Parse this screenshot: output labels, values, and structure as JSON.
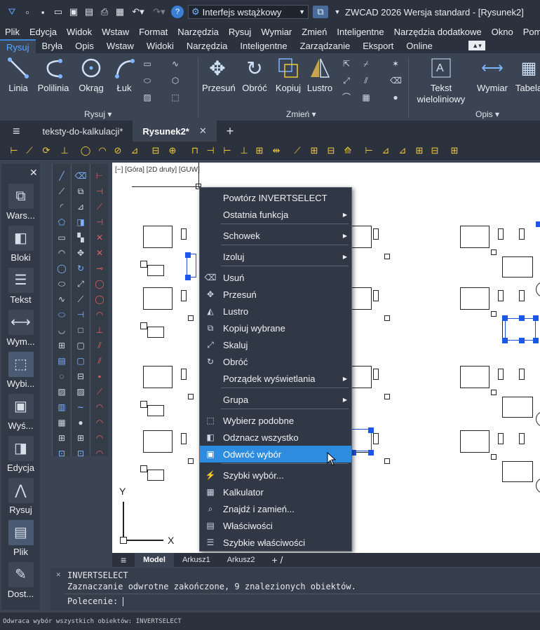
{
  "app": {
    "workspace": "Interfejs wstążkowy",
    "title": "ZWCAD 2026 Wersja standard - [Rysunek2]"
  },
  "menu": [
    "Plik",
    "Edycja",
    "Widok",
    "Wstaw",
    "Format",
    "Narzędzia",
    "Rysuj",
    "Wymiar",
    "Zmień",
    "Inteligentne",
    "Narzędzia dodatkowe",
    "Okno",
    "Pomo"
  ],
  "ribbon_tabs": [
    "Rysuj",
    "Bryła",
    "Opis",
    "Wstaw",
    "Widoki",
    "Narzędzia",
    "Inteligentne",
    "Zarządzanie",
    "Eksport",
    "Online"
  ],
  "ribbon": {
    "draw_buttons": [
      "Linia",
      "Polilinia",
      "Okrąg",
      "Łuk"
    ],
    "modify_buttons": [
      "Przesuń",
      "Obróć",
      "Kopiuj",
      "Lustro"
    ],
    "annot_buttons": [
      "Tekst\nwieloliniowy",
      "Wymiar",
      "Tabela"
    ],
    "groups": {
      "draw": "Rysuj",
      "modify": "Zmień",
      "annot": "Opis"
    }
  },
  "doc_tabs": [
    "teksty-do-kalkulacji*",
    "Rysunek2*"
  ],
  "viewport_label": "[−] [Góra] [2D druty] [GUW]",
  "left_palette": [
    "Wars...",
    "Bloki",
    "Tekst",
    "Wym...",
    "Wybi...",
    "Wyś...",
    "Edycja",
    "Rysuj",
    "Plik",
    "Dost..."
  ],
  "axis": {
    "y": "Y",
    "x": "X"
  },
  "context_menu": [
    {
      "label": "Powtórz INVERTSELECT",
      "icon": "",
      "submenu": false
    },
    {
      "label": "Ostatnia funkcja",
      "icon": "",
      "submenu": true
    },
    {
      "label": "Schowek",
      "icon": "",
      "submenu": true
    },
    {
      "label": "Izoluj",
      "icon": "",
      "submenu": true
    },
    {
      "label": "Usuń",
      "icon": "eraser-icon",
      "submenu": false
    },
    {
      "label": "Przesuń",
      "icon": "move-icon",
      "submenu": false
    },
    {
      "label": "Lustro",
      "icon": "mirror-icon",
      "submenu": false
    },
    {
      "label": "Kopiuj wybrane",
      "icon": "copy-icon",
      "submenu": false
    },
    {
      "label": "Skaluj",
      "icon": "scale-icon",
      "submenu": false
    },
    {
      "label": "Obróć",
      "icon": "rotate-icon",
      "submenu": false
    },
    {
      "label": "Porządek wyświetlania",
      "icon": "",
      "submenu": true
    },
    {
      "label": "Grupa",
      "icon": "",
      "submenu": true
    },
    {
      "label": "Wybierz podobne",
      "icon": "select-similar-icon",
      "submenu": false
    },
    {
      "label": "Odznacz wszystko",
      "icon": "deselect-icon",
      "submenu": false
    },
    {
      "label": "Odwróć wybór",
      "icon": "invert-selection-icon",
      "submenu": false
    },
    {
      "label": "Szybki wybór...",
      "icon": "quick-select-icon",
      "submenu": false
    },
    {
      "label": "Kalkulator",
      "icon": "calculator-icon",
      "submenu": false
    },
    {
      "label": "Znajdź i zamień...",
      "icon": "find-icon",
      "submenu": false
    },
    {
      "label": "Właściwości",
      "icon": "properties-icon",
      "submenu": false
    },
    {
      "label": "Szybkie właściwości",
      "icon": "quick-properties-icon",
      "submenu": false
    }
  ],
  "layout_tabs": [
    "Model",
    "Arkusz1",
    "Arkusz2"
  ],
  "command": {
    "line1": "INVERTSELECT",
    "line2": "Zaznaczanie odwrotne zakończone, 9 znalezionych obiektów.",
    "prompt": "Polecenie:"
  },
  "status_text": "Odwraca wybór wszystkich obiektów: INVERTSELECT"
}
